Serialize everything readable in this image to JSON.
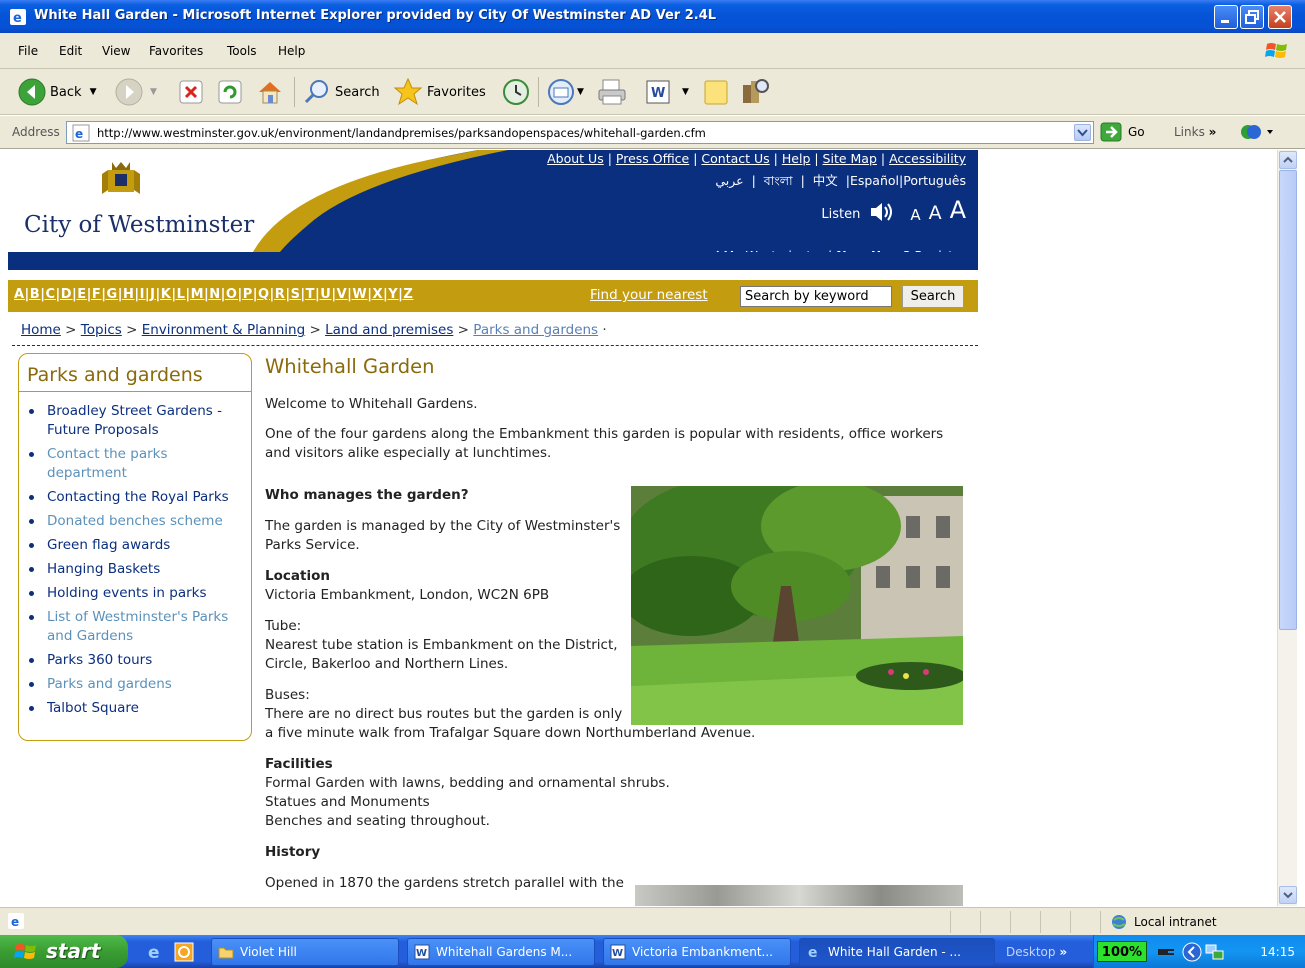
{
  "window": {
    "title": "White Hall Garden - Microsoft Internet Explorer provided by City Of Westminster AD Ver 2.4L"
  },
  "menu": [
    "File",
    "Edit",
    "View",
    "Favorites",
    "Tools",
    "Help"
  ],
  "toolbar": {
    "back": "Back",
    "search": "Search",
    "favorites": "Favorites"
  },
  "address": {
    "label": "Address",
    "url": "http://www.westminster.gov.uk/environment/landandpremises/parksandopenspaces/whitehall-garden.cfm",
    "go": "Go",
    "links": "Links"
  },
  "site": {
    "brand": "City of Westminster",
    "top_links": [
      "About Us",
      "Press Office",
      "Contact Us",
      "Help",
      "Site Map",
      "Accessibility"
    ],
    "lang_arabic": "عربي",
    "lang_bengali": "বাংলা",
    "lang_chinese": "中文",
    "lang_espanol": "Español",
    "lang_portugues": "Português",
    "listen": "Listen",
    "text_size": "A",
    "my_westminster": "My Westminster",
    "new_user": "New User?",
    "register": "Register",
    "az": "A|B|C|D|E|F|G|H|I|J|K|L|M|N|O|P|Q|R|S|T|U|V|W|X|Y|Z",
    "find_nearest": "Find your nearest",
    "search_placeholder": "Search by keyword",
    "search_button": "Search"
  },
  "breadcrumb": {
    "home": "Home",
    "topics": "Topics",
    "env": "Environment & Planning",
    "land": "Land and premises",
    "parks": "Parks and gardens",
    "sep": ">"
  },
  "sidebar": {
    "title": "Parks and gardens",
    "items": [
      "Broadley Street Gardens - Future Proposals",
      "Contact the parks department",
      "Contacting the Royal Parks",
      "Donated benches scheme",
      "Green flag awards",
      "Hanging Baskets",
      "Holding events in parks",
      "List of Westminster's Parks and Gardens",
      "Parks 360 tours",
      "Parks and gardens",
      "Talbot Square"
    ]
  },
  "article": {
    "title": "Whitehall Garden",
    "welcome": "Welcome to Whitehall Gardens.",
    "intro": "One of the four gardens along the Embankment this garden is popular with residents, office workers and visitors alike especially at lunchtimes.",
    "who_heading": "Who manages the garden?",
    "who_text": "The garden is managed by the City of Westminster's Parks Service.",
    "location_heading": "Location",
    "location_text": "Victoria Embankment, London, WC2N 6PB",
    "tube_heading": "Tube:",
    "tube_text": "Nearest tube station is Embankment on the District, Circle, Bakerloo and Northern Lines.",
    "buses_heading": "Buses:",
    "buses_text_1": "There are no direct bus routes but the garden is only",
    "buses_text_2": "a five minute walk from Trafalgar Square down Northumberland Avenue.",
    "facilities_heading": "Facilities",
    "facilities": [
      "Formal Garden with lawns, bedding and ornamental shrubs.",
      "Statues and Monuments",
      "Benches and seating throughout."
    ],
    "history_heading": "History",
    "history_text": "Opened in 1870 the gardens stretch parallel with the"
  },
  "status": {
    "zone": "Local intranet"
  },
  "taskbar": {
    "start": "start",
    "tasks": [
      "Violet Hill",
      "Whitehall Gardens M...",
      "Victoria Embankment...",
      "White Hall Garden - ..."
    ],
    "desktop": "Desktop",
    "zoom": "100%",
    "clock": "14:15"
  }
}
